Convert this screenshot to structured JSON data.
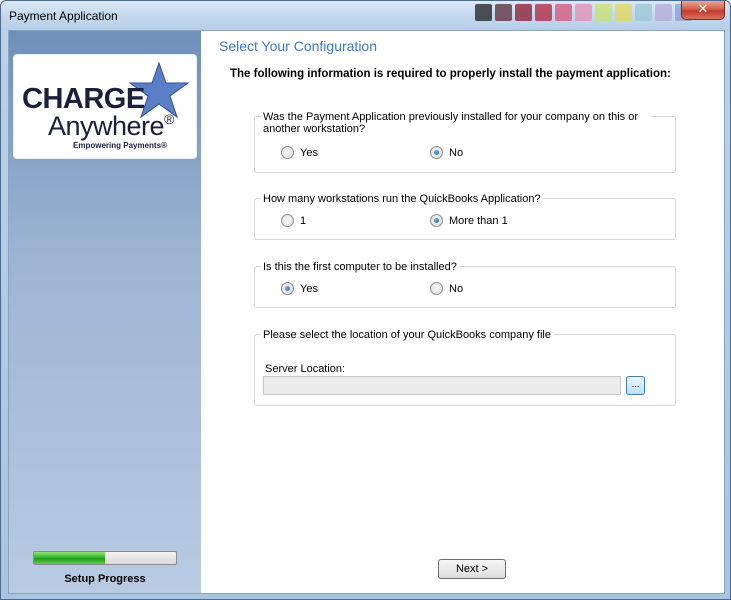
{
  "window": {
    "title": "Payment Application",
    "close_label": "x"
  },
  "sidebar": {
    "logo": {
      "line1": "CHARGE",
      "line2": "Anywhere",
      "reg": "®",
      "tagline": "Empowering Payments®"
    },
    "progress": {
      "fraction": 0.5,
      "label": "Setup Progress"
    }
  },
  "main": {
    "heading": "Select Your Configuration",
    "intro": "The following information is required to properly install the payment application:",
    "groups": [
      {
        "question": "Was the Payment Application previously installed for your company on this or another workstation?",
        "options": [
          {
            "label": "Yes",
            "checked": false
          },
          {
            "label": "No",
            "checked": true
          }
        ]
      },
      {
        "question": "How many workstations run the QuickBooks Application?",
        "options": [
          {
            "label": "1",
            "checked": false
          },
          {
            "label": "More than 1",
            "checked": true
          }
        ]
      },
      {
        "question": "Is this the first computer to be installed?",
        "options": [
          {
            "label": "Yes",
            "checked": true
          },
          {
            "label": "No",
            "checked": false
          }
        ]
      }
    ],
    "location": {
      "question": "Please select the location of your QuickBooks company file",
      "server_label": "Server Location:",
      "server_value": "",
      "browse_label": "..."
    },
    "next_label": "Next >"
  },
  "colors": {
    "heading": "#3b7cc0",
    "sidebar": "#9db4d3",
    "progress": "#37b52a"
  }
}
